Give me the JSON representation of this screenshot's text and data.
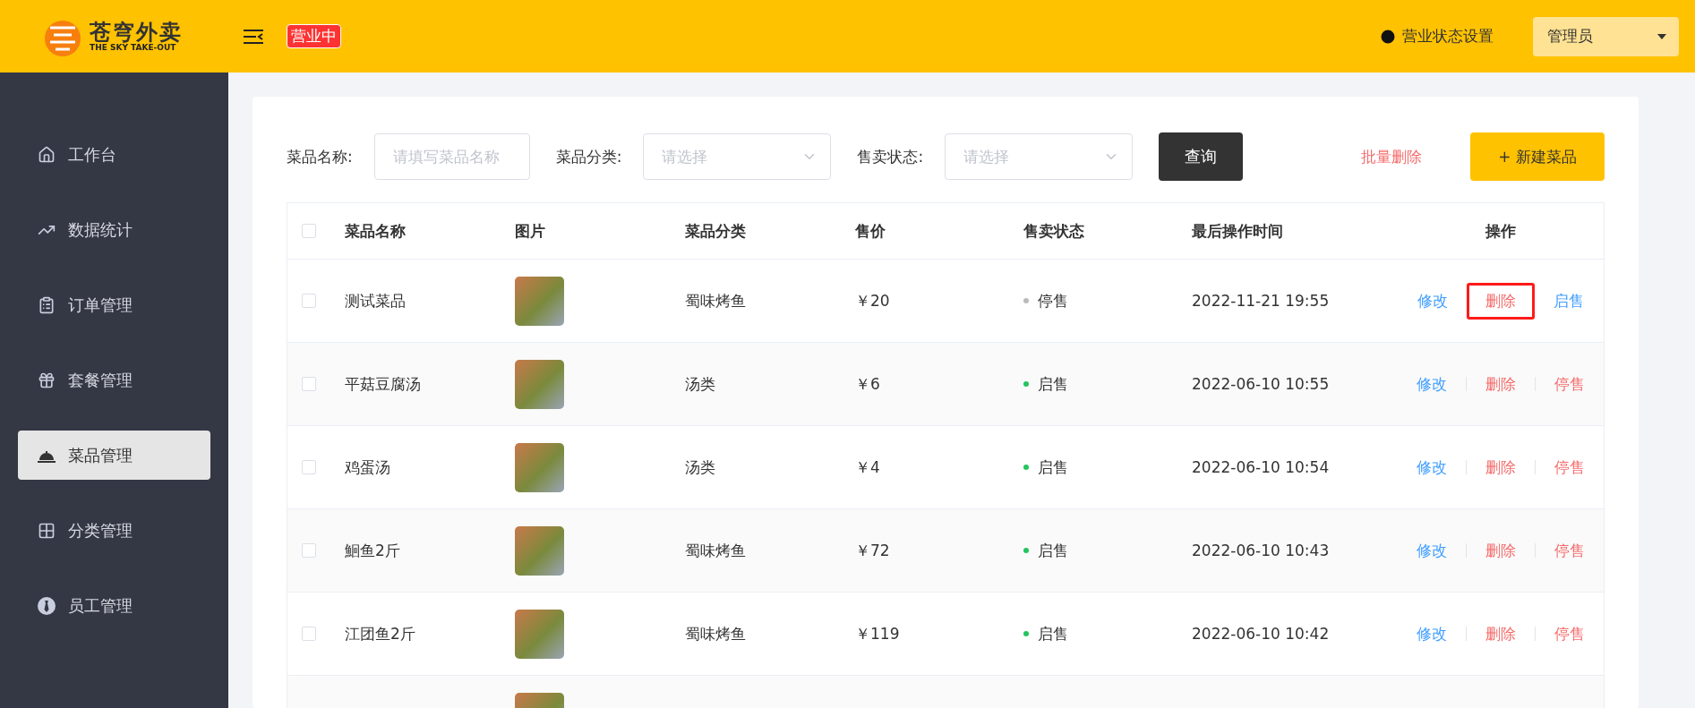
{
  "header": {
    "logo_title": "苍穹外卖",
    "logo_subtitle": "THE SKY TAKE-OUT",
    "status_badge": "营业中",
    "status_setting": "营业状态设置",
    "user": "管理员"
  },
  "sidebar": {
    "items": [
      {
        "label": "工作台",
        "selected": false
      },
      {
        "label": "数据统计",
        "selected": false
      },
      {
        "label": "订单管理",
        "selected": false
      },
      {
        "label": "套餐管理",
        "selected": false
      },
      {
        "label": "菜品管理",
        "selected": true
      },
      {
        "label": "分类管理",
        "selected": false
      },
      {
        "label": "员工管理",
        "selected": false
      }
    ]
  },
  "filters": {
    "name_label": "菜品名称:",
    "name_placeholder": "请填写菜品名称",
    "category_label": "菜品分类:",
    "category_placeholder": "请选择",
    "status_label": "售卖状态:",
    "status_placeholder": "请选择",
    "query_button": "查询",
    "batch_delete": "批量删除",
    "new_button": "+ 新建菜品"
  },
  "table": {
    "all_checked": false,
    "columns": [
      "菜品名称",
      "图片",
      "菜品分类",
      "售价",
      "售卖状态",
      "最后操作时间",
      "操作"
    ],
    "rows": [
      {
        "kind": "full",
        "checked": false,
        "name": "测试菜品",
        "category": "蜀味烤鱼",
        "price": "￥20",
        "on_sale": false,
        "status": "停售",
        "time": "2022-11-21 19:55",
        "actions": [
          "修改",
          "删除",
          "启售"
        ],
        "highlighted": true
      },
      {
        "kind": "full",
        "checked": false,
        "name": "平菇豆腐汤",
        "category": "汤类",
        "price": "￥6",
        "on_sale": true,
        "status": "启售",
        "time": "2022-06-10 10:55",
        "actions": [
          "修改",
          "删除",
          "停售"
        ],
        "highlighted": false
      },
      {
        "kind": "full",
        "checked": false,
        "name": "鸡蛋汤",
        "category": "汤类",
        "price": "￥4",
        "on_sale": true,
        "status": "启售",
        "time": "2022-06-10 10:54",
        "actions": [
          "修改",
          "删除",
          "停售"
        ],
        "highlighted": false
      },
      {
        "kind": "full",
        "checked": false,
        "name": "鮰鱼2斤",
        "category": "蜀味烤鱼",
        "price": "￥72",
        "on_sale": true,
        "status": "启售",
        "time": "2022-06-10 10:43",
        "actions": [
          "修改",
          "删除",
          "停售"
        ],
        "highlighted": false
      },
      {
        "kind": "full",
        "checked": false,
        "name": "江团鱼2斤",
        "category": "蜀味烤鱼",
        "price": "￥119",
        "on_sale": true,
        "status": "启售",
        "time": "2022-06-10 10:42",
        "actions": [
          "修改",
          "删除",
          "停售"
        ],
        "highlighted": false
      },
      {
        "kind": "cut"
      }
    ]
  }
}
